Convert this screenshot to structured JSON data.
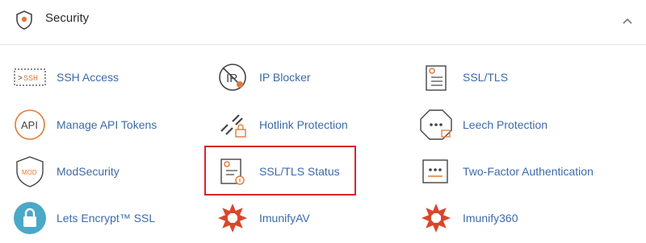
{
  "header": {
    "title": "Security",
    "icon": "shield-icon",
    "collapse_icon": "chevron-up-icon"
  },
  "colors": {
    "link": "#3c6aa8",
    "accent": "#e07b39",
    "highlight": "#d9232e",
    "lock_bg": "#4aa8c8"
  },
  "items": [
    {
      "label": "SSH Access",
      "icon": "ssh-terminal-icon"
    },
    {
      "label": "IP Blocker",
      "icon": "ip-blocker-icon"
    },
    {
      "label": "SSL/TLS",
      "icon": "certificate-icon"
    },
    {
      "label": "Manage API Tokens",
      "icon": "api-icon"
    },
    {
      "label": "Hotlink Protection",
      "icon": "broken-link-lock-icon"
    },
    {
      "label": "Leech Protection",
      "icon": "octagon-password-icon"
    },
    {
      "label": "ModSecurity",
      "icon": "modsecurity-shield-icon"
    },
    {
      "label": "SSL/TLS Status",
      "icon": "certificate-status-icon",
      "highlighted": true
    },
    {
      "label": "Two-Factor Authentication",
      "icon": "two-factor-icon"
    },
    {
      "label": "Lets Encrypt™ SSL",
      "icon": "padlock-icon"
    },
    {
      "label": "ImunifyAV",
      "icon": "imunify-icon"
    },
    {
      "label": "Imunify360",
      "icon": "imunify360-icon"
    }
  ]
}
